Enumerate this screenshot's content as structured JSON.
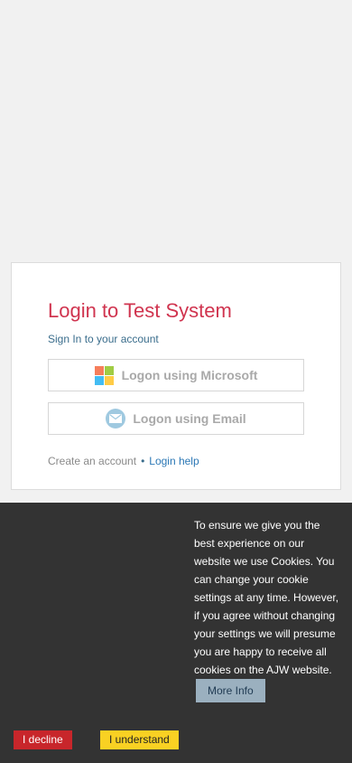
{
  "login": {
    "title": "Login to Test System",
    "subtitle": "Sign In to your account",
    "microsoft_button": "Logon using Microsoft",
    "email_button": "Logon using Email",
    "create_account": "Create an account",
    "separator": "•",
    "login_help": "Login help",
    "title_color": "#d0344f"
  },
  "icons": {
    "microsoft": "microsoft-logo-icon",
    "email": "envelope-icon"
  },
  "cookie": {
    "message": "To ensure we give you the best experience on our website we use Cookies. You can change your cookie settings at any time. However, if you agree without changing your settings we will presume you are happy to receive all cookies on the AJW website.",
    "more_info": "More Info",
    "decline": "I decline",
    "accept": "I understand",
    "decline_color": "#c8262b",
    "accept_color": "#f9d123"
  }
}
